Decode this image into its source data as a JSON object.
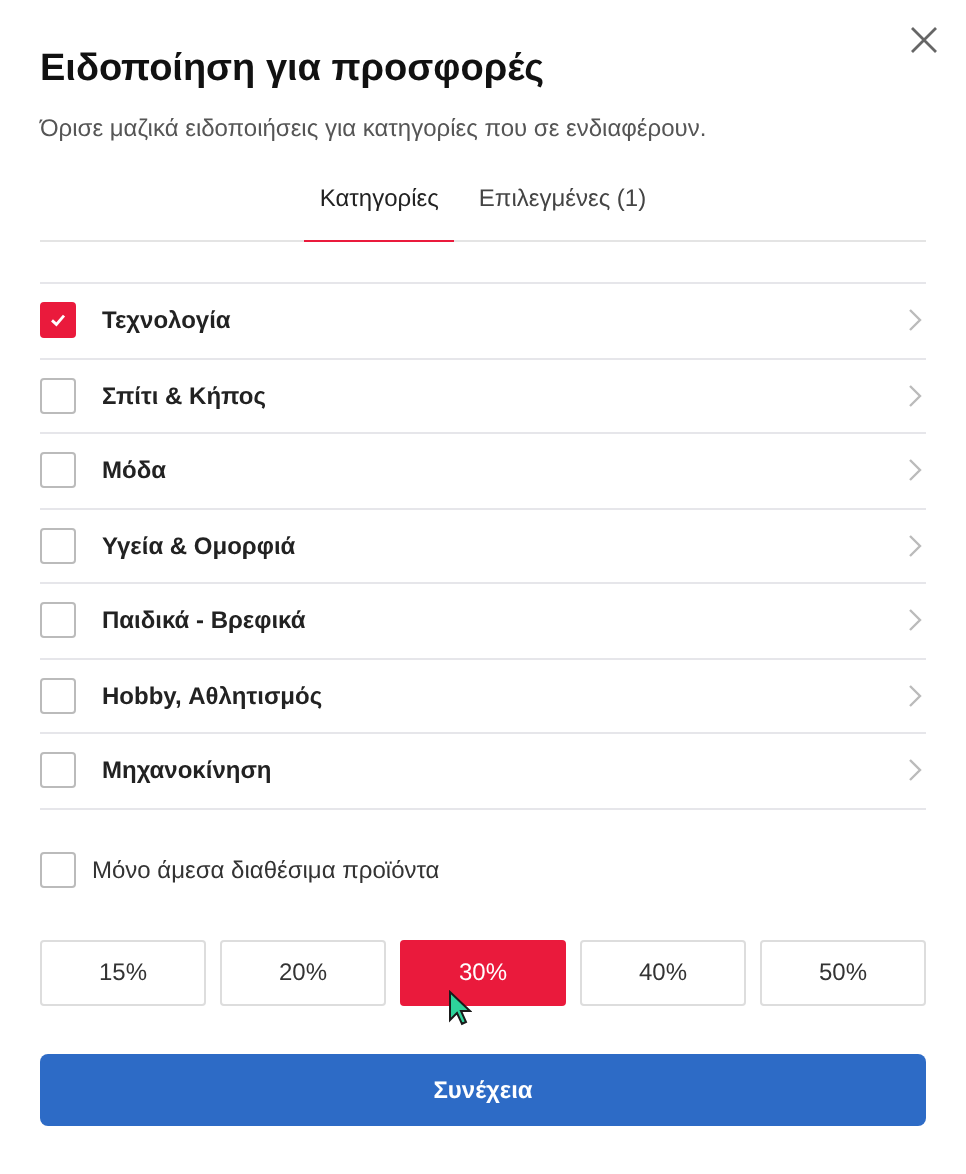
{
  "dialog": {
    "title": "Ειδοποίηση για προσφορές",
    "subtitle": "Όρισε μαζικά ειδοποιήσεις για κατηγορίες που σε ενδιαφέρουν."
  },
  "tabs": [
    {
      "label": "Κατηγορίες",
      "selected": true
    },
    {
      "label": "Επιλεγμένες (1)",
      "selected": false
    }
  ],
  "categories": [
    {
      "label": "Τεχνολογία",
      "checked": true
    },
    {
      "label": "Σπίτι & Κήπος",
      "checked": false
    },
    {
      "label": "Μόδα",
      "checked": false
    },
    {
      "label": "Υγεία & Ομορφιά",
      "checked": false
    },
    {
      "label": "Παιδικά - Βρεφικά",
      "checked": false
    },
    {
      "label": "Hobby, Αθλητισμός",
      "checked": false
    },
    {
      "label": "Μηχανοκίνηση",
      "checked": false
    }
  ],
  "in_stock_only": {
    "label": "Μόνο άμεσα διαθέσιμα προϊόντα",
    "checked": false
  },
  "discounts": [
    {
      "label": "15%",
      "selected": false
    },
    {
      "label": "20%",
      "selected": false
    },
    {
      "label": "30%",
      "selected": true
    },
    {
      "label": "40%",
      "selected": false
    },
    {
      "label": "50%",
      "selected": false
    }
  ],
  "continue_button": "Συνέχεια"
}
